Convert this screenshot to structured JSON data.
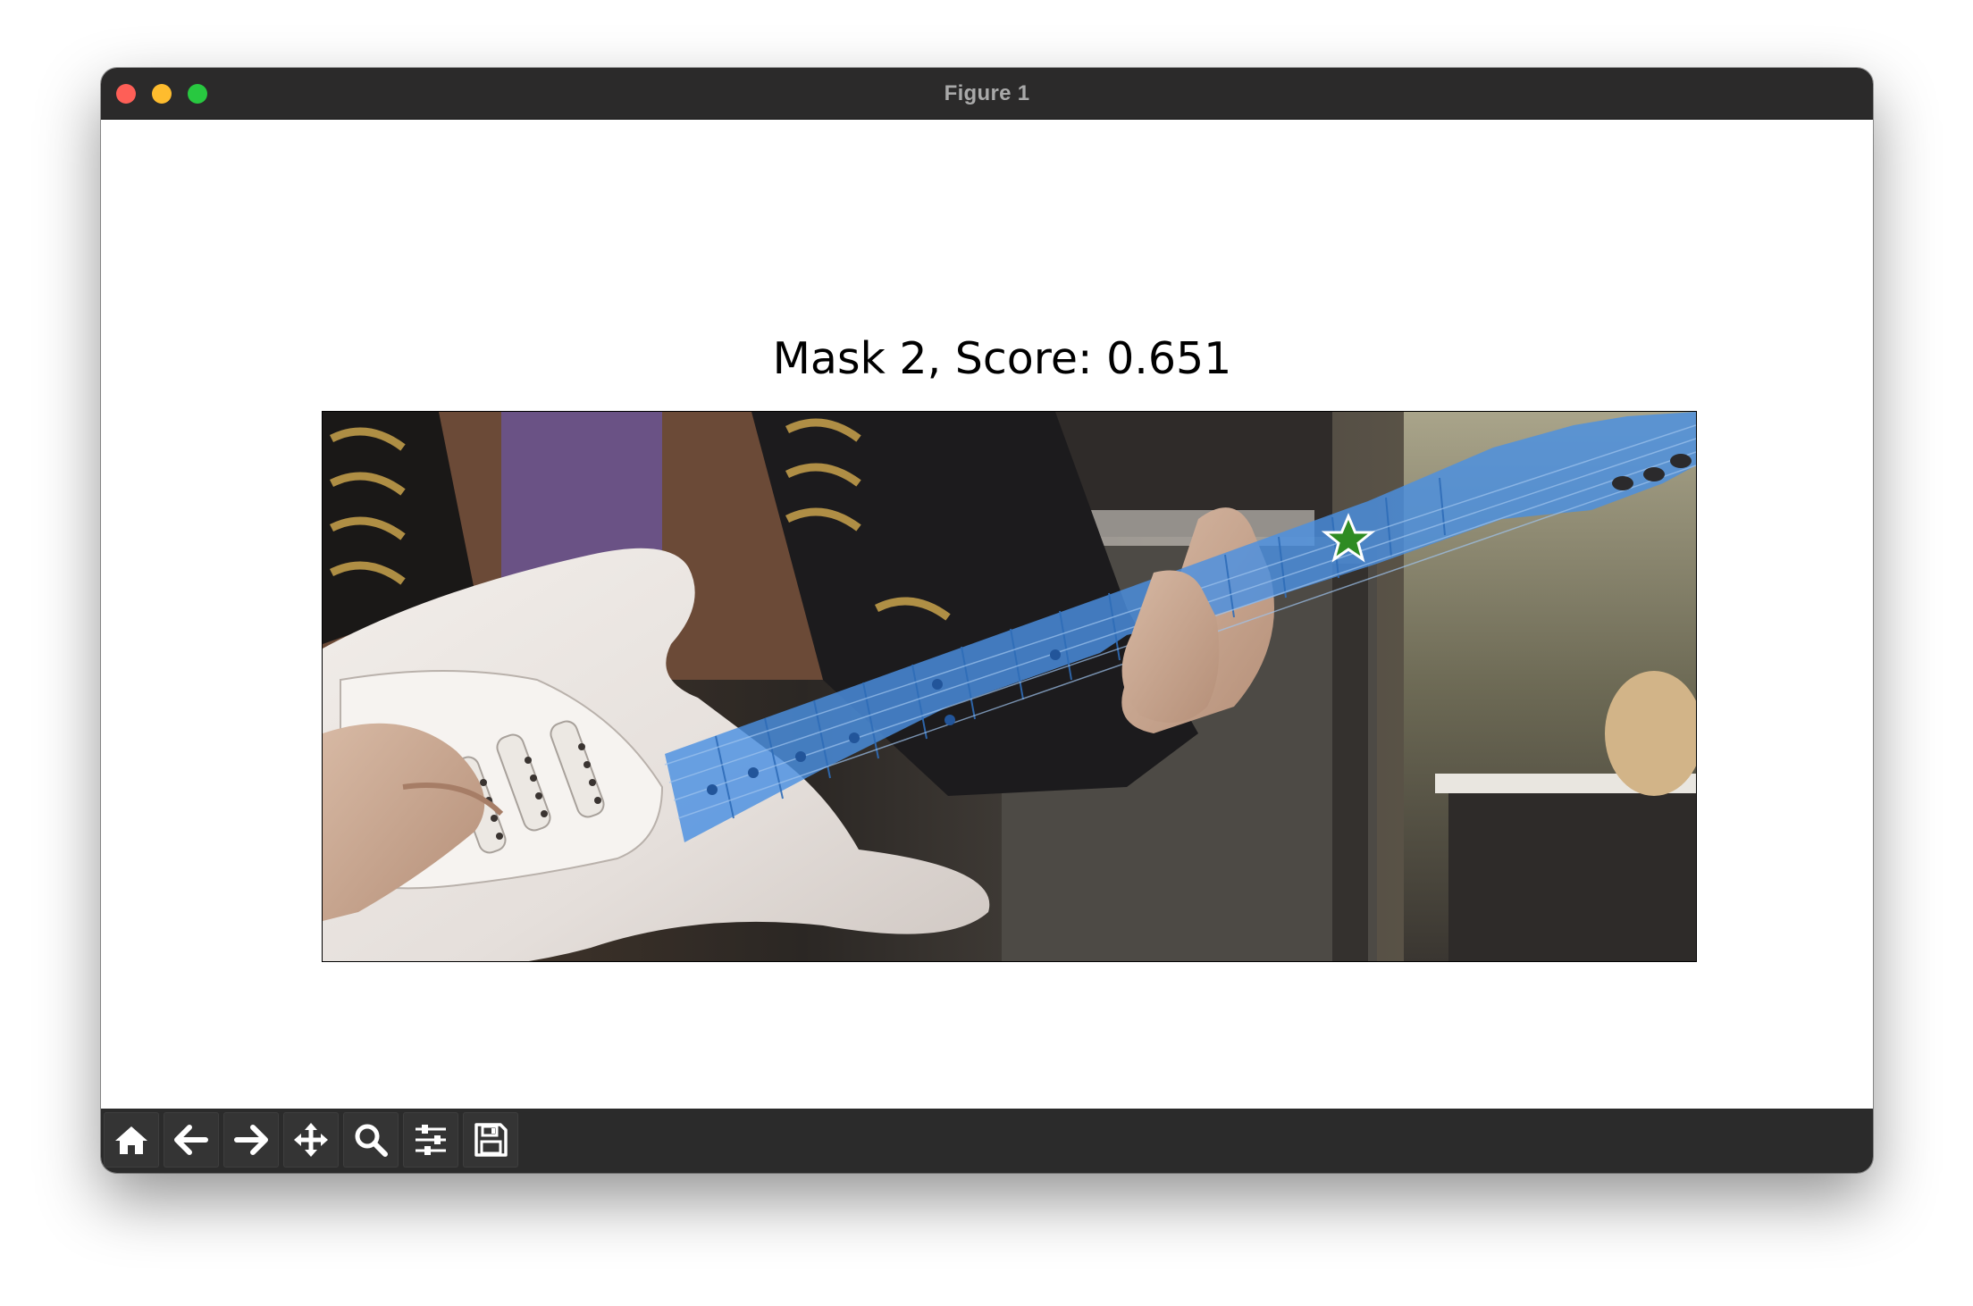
{
  "window": {
    "title": "Figure 1"
  },
  "figure": {
    "title": "Mask 2, Score: 0.651",
    "mask_color": "#4a90e2",
    "marker_color": "#2e8b22",
    "marker_symbol": "star"
  },
  "toolbar": {
    "buttons": [
      {
        "name": "home",
        "icon": "home-icon"
      },
      {
        "name": "back",
        "icon": "arrow-left-icon"
      },
      {
        "name": "forward",
        "icon": "arrow-right-icon"
      },
      {
        "name": "pan",
        "icon": "move-icon"
      },
      {
        "name": "zoom",
        "icon": "magnifier-icon"
      },
      {
        "name": "configure-subplots",
        "icon": "sliders-icon"
      },
      {
        "name": "save",
        "icon": "floppy-disk-icon"
      }
    ]
  }
}
